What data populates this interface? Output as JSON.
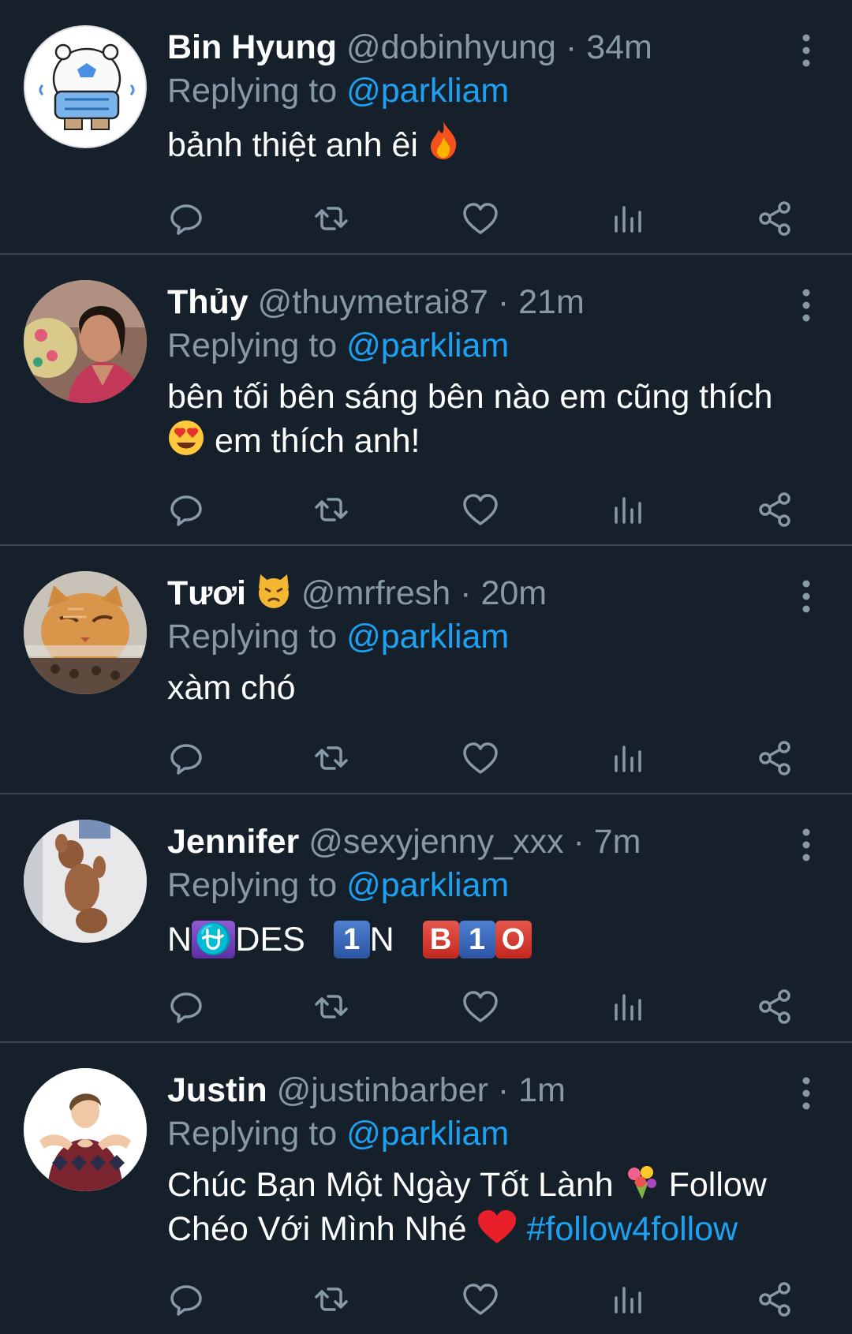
{
  "tweets": [
    {
      "name": "Bin Hyung",
      "handle": "@dobinhyung",
      "time": "34m",
      "reply_label": "Replying to",
      "reply_handle": "@parkliam",
      "text": "bảnh thiệt anh êi",
      "emoji": "fire-emoji",
      "avatar": "cartoon-bear-avatar"
    },
    {
      "name": "Thủy",
      "handle": "@thuymetrai87",
      "time": "21m",
      "reply_label": "Replying to",
      "reply_handle": "@parkliam",
      "text_prefix": "bên tối bên sáng bên nào em cũng thích",
      "emoji": "heart-eyes-emoji",
      "text_suffix": "em thích anh!",
      "avatar": "woman-photo-avatar"
    },
    {
      "name": "Tươi",
      "name_emoji": "pouting-cat-emoji",
      "handle": "@mrfresh",
      "time": "20m",
      "reply_label": "Replying to",
      "reply_handle": "@parkliam",
      "text": "xàm chó",
      "avatar": "cat-photo-avatar"
    },
    {
      "name": "Jennifer",
      "handle": "@sexyjenny_xxx",
      "time": "7m",
      "reply_label": "Replying to",
      "reply_handle": "@parkliam",
      "text_parts": [
        "N",
        "⛎",
        "DES",
        "1",
        "N",
        "B",
        "1",
        "O"
      ],
      "avatar": "poodle-photo-avatar"
    },
    {
      "name": "Justin",
      "handle": "@justinbarber",
      "time": "1m",
      "reply_label": "Replying to",
      "reply_handle": "@parkliam",
      "text_line1_prefix": "Chúc Bạn Một Ngày Tốt Lành",
      "text_line1_suffix": "Follow",
      "text_line2_prefix": "Chéo Với Mình Nhé",
      "hashtag": "#follow4follow",
      "avatar": "man-photo-avatar"
    }
  ],
  "separator": "·",
  "icons": [
    "reply-icon",
    "retweet-icon",
    "like-icon",
    "stats-icon",
    "share-icon",
    "more-icon"
  ],
  "colors": {
    "background": "#15202b",
    "divider": "#38444d",
    "muted": "#8899a6",
    "link": "#1da1f2",
    "text": "#ffffff"
  }
}
